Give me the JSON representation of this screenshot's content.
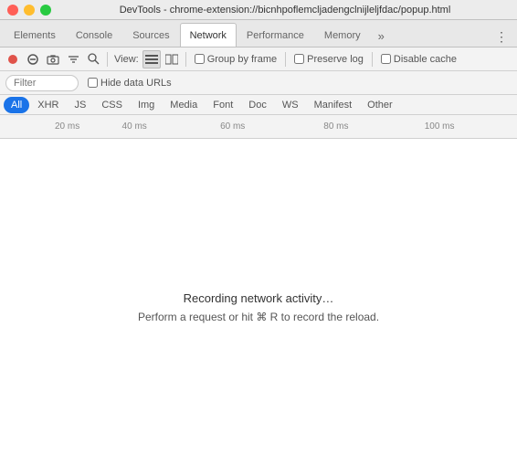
{
  "window": {
    "title": "DevTools - chrome-extension://bicnhpoflemcljadengclnijleljfdac/popup.html",
    "controls": {
      "close": "close",
      "minimize": "minimize",
      "maximize": "maximize"
    }
  },
  "tabs": [
    {
      "id": "elements",
      "label": "Elements",
      "active": false
    },
    {
      "id": "console",
      "label": "Console",
      "active": false
    },
    {
      "id": "sources",
      "label": "Sources",
      "active": false
    },
    {
      "id": "network",
      "label": "Network",
      "active": true
    },
    {
      "id": "performance",
      "label": "Performance",
      "active": false
    },
    {
      "id": "memory",
      "label": "Memory",
      "active": false
    }
  ],
  "tabs_more": "»",
  "tabs_menu": "⋮",
  "toolbar": {
    "record_tooltip": "Record network log",
    "stop_tooltip": "Stop recording",
    "clear_tooltip": "Clear",
    "filter_tooltip": "Filter",
    "search_tooltip": "Search",
    "view_label": "View:",
    "view_list": "list",
    "view_grouped": "grouped",
    "group_by_frame_label": "Group by frame",
    "preserve_log_label": "Preserve log",
    "disable_cache_label": "Disable cache"
  },
  "filter_bar": {
    "placeholder": "Filter",
    "hide_data_urls_label": "Hide data URLs"
  },
  "type_filters": [
    {
      "id": "all",
      "label": "All",
      "active": true
    },
    {
      "id": "xhr",
      "label": "XHR",
      "active": false
    },
    {
      "id": "js",
      "label": "JS",
      "active": false
    },
    {
      "id": "css",
      "label": "CSS",
      "active": false
    },
    {
      "id": "img",
      "label": "Img",
      "active": false
    },
    {
      "id": "media",
      "label": "Media",
      "active": false
    },
    {
      "id": "font",
      "label": "Font",
      "active": false
    },
    {
      "id": "doc",
      "label": "Doc",
      "active": false
    },
    {
      "id": "ws",
      "label": "WS",
      "active": false
    },
    {
      "id": "manifest",
      "label": "Manifest",
      "active": false
    },
    {
      "id": "other",
      "label": "Other",
      "active": false
    }
  ],
  "timeline": {
    "ticks": [
      {
        "label": "20 ms",
        "percent": 13
      },
      {
        "label": "40 ms",
        "percent": 26
      },
      {
        "label": "60 ms",
        "percent": 45
      },
      {
        "label": "80 ms",
        "percent": 65
      },
      {
        "label": "100 ms",
        "percent": 85
      }
    ]
  },
  "empty_state": {
    "main_text": "Recording network activity…",
    "sub_text": "Perform a request or hit ⌘ R to record the reload."
  },
  "colors": {
    "accent_blue": "#1a73e8",
    "record_red": "#e0534a"
  }
}
